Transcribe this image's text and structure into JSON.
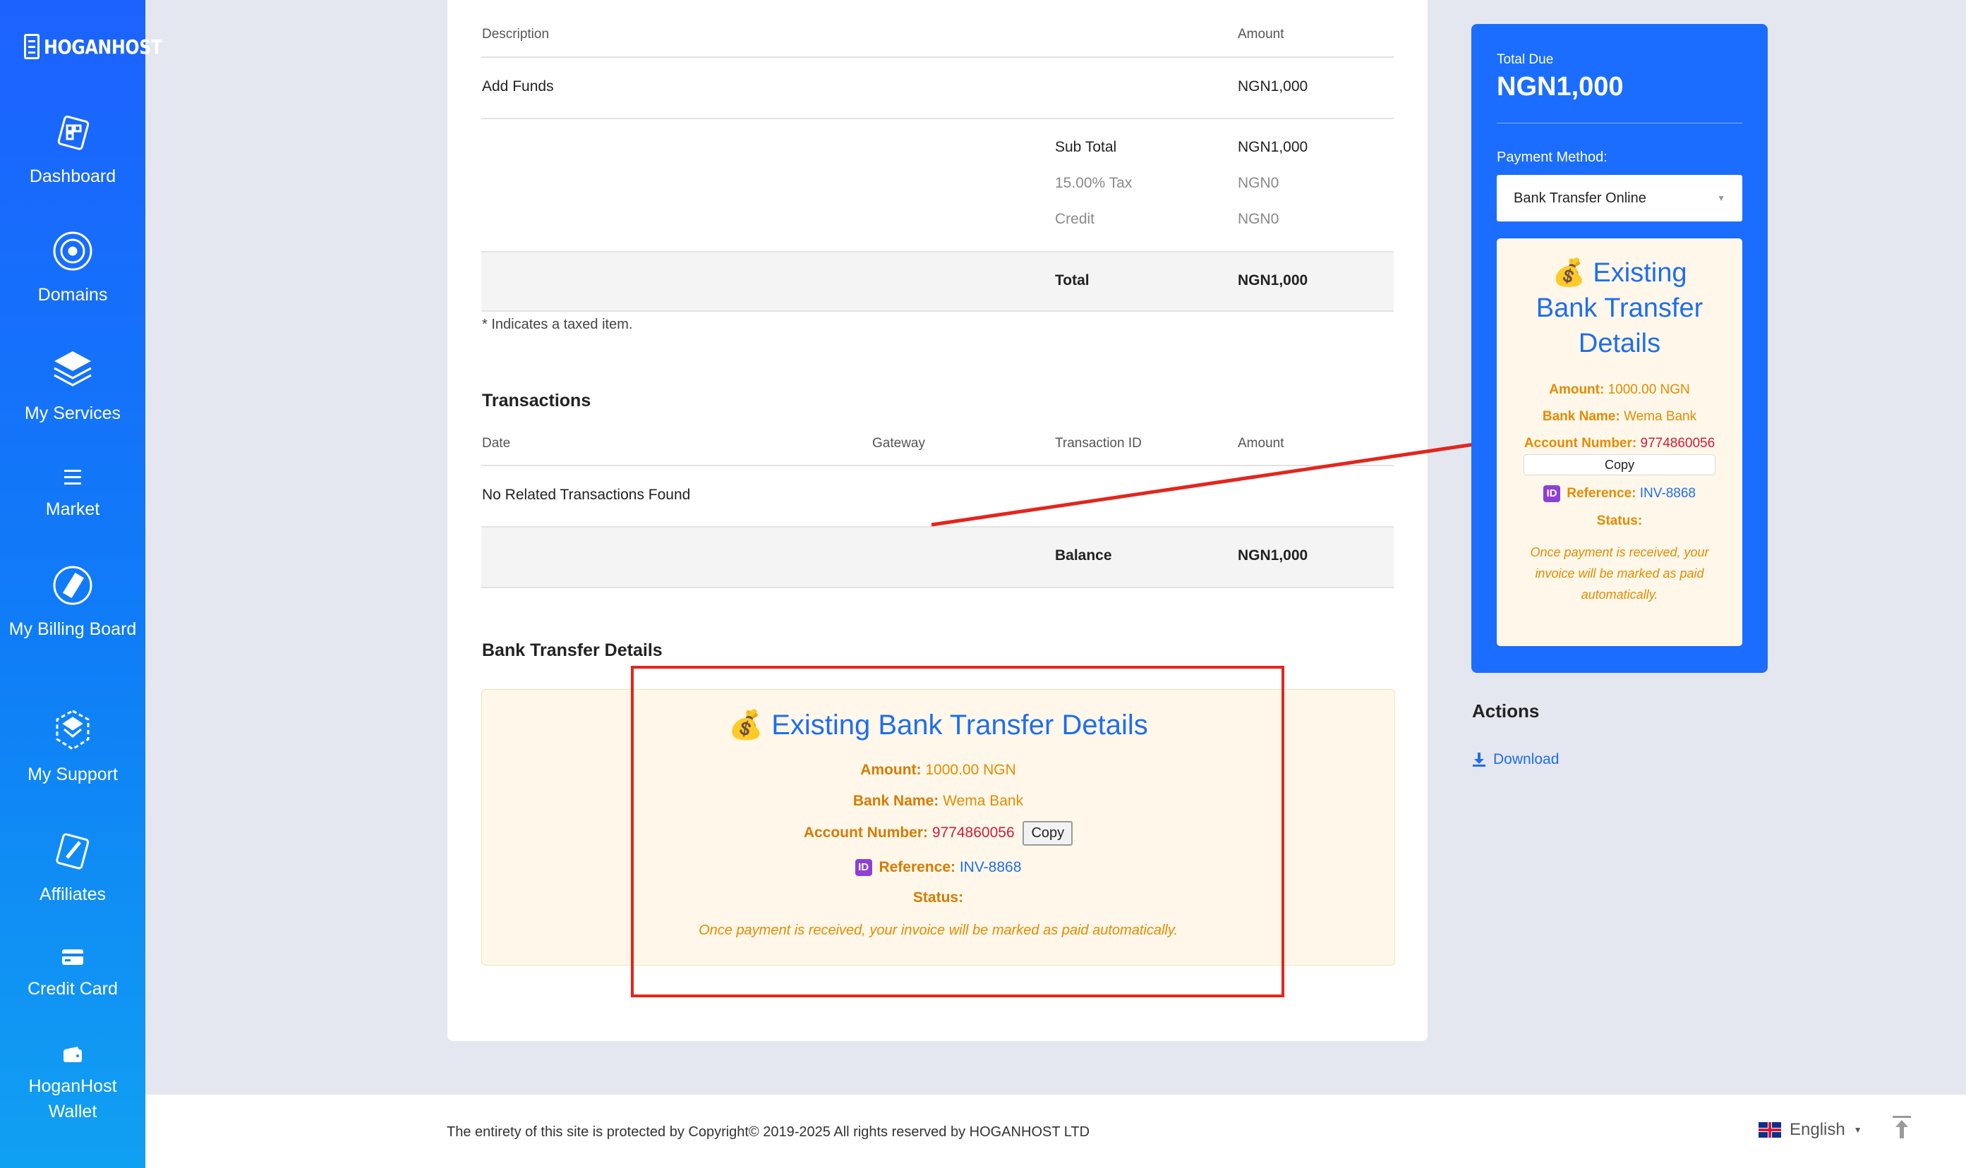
{
  "brand": {
    "name": "HOGANHOST"
  },
  "sidebar": {
    "items": [
      {
        "label": "Dashboard",
        "icon": "dashboard-icon"
      },
      {
        "label": "Domains",
        "icon": "globe-icon"
      },
      {
        "label": "My Services",
        "icon": "layers-icon"
      },
      {
        "label": "Market",
        "icon": "menu-icon"
      },
      {
        "label": "My Billing Board",
        "icon": "billing-icon"
      },
      {
        "label": "My Support",
        "icon": "support-icon"
      },
      {
        "label": "Affiliates",
        "icon": "affiliates-icon"
      },
      {
        "label": "Credit Card",
        "icon": "credit-card-icon"
      },
      {
        "label": "HoganHost Wallet",
        "icon": "wallet-icon"
      }
    ]
  },
  "invoice": {
    "headers": {
      "description": "Description",
      "amount": "Amount"
    },
    "item": {
      "description": "Add Funds",
      "amount": "NGN1,000"
    },
    "subtotal": {
      "label": "Sub Total",
      "value": "NGN1,000"
    },
    "tax": {
      "label": "15.00% Tax",
      "value": "NGN0"
    },
    "credit": {
      "label": "Credit",
      "value": "NGN0"
    },
    "total": {
      "label": "Total",
      "value": "NGN1,000"
    },
    "taxed_note": "* Indicates a taxed item."
  },
  "transactions": {
    "title": "Transactions",
    "headers": {
      "date": "Date",
      "gateway": "Gateway",
      "transaction_id": "Transaction ID",
      "amount": "Amount"
    },
    "empty": "No Related Transactions Found",
    "balance": {
      "label": "Balance",
      "value": "NGN1,000"
    }
  },
  "bank_transfer": {
    "section_title": "Bank Transfer Details",
    "title_emoji": "💰",
    "title": "Existing Bank Transfer Details",
    "amount_label": "Amount:",
    "amount_value": "1000.00 NGN",
    "bank_label": "Bank Name:",
    "bank_value": "Wema Bank",
    "account_label": "Account Number:",
    "account_value": "9774860056",
    "copy_label": "Copy",
    "reference_emoji": "ID",
    "reference_label": "Reference:",
    "reference_value": "INV-8868",
    "status_label": "Status:",
    "note": "Once payment is received, your invoice will be marked as paid automatically."
  },
  "summary": {
    "total_due_label": "Total Due",
    "total_due_value": "NGN1,000",
    "payment_method_label": "Payment Method:",
    "payment_method_value": "Bank Transfer Online",
    "inner_title_emoji": "💰",
    "inner_title_line1": "Existing",
    "inner_title_line2": "Bank Transfer",
    "inner_title_line3": "Details",
    "inner_note_1": "Once payment is received, your",
    "inner_note_2": "invoice will be marked as paid",
    "inner_note_3": "automatically."
  },
  "actions": {
    "title": "Actions",
    "download_label": "Download"
  },
  "footer": {
    "copyright": "The entirety of this site is protected by Copyright© 2019-2025 All rights reserved by HOGANHOST LTD",
    "language": "English"
  },
  "colors": {
    "sidebar": "#1c62ff",
    "accent": "#1f6df0",
    "warning": "#e68a00",
    "annotation": "#e2261d"
  }
}
